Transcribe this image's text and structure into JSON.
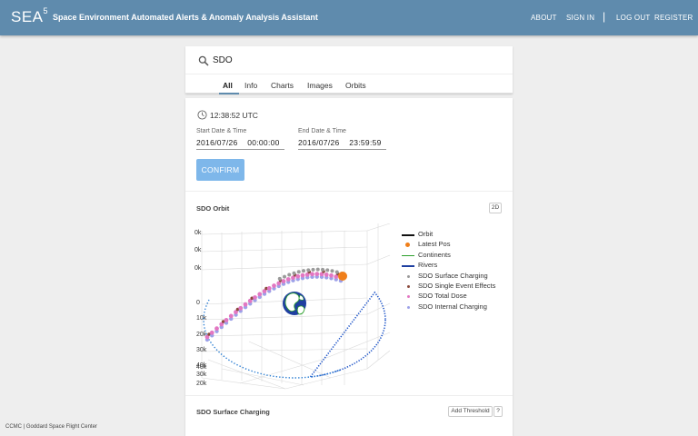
{
  "header": {
    "logo": "SEA",
    "logo_sup": "5",
    "title": "Space Environment Automated Alerts & Anomaly Analysis Assistant",
    "nav": [
      "ABOUT",
      "SIGN IN",
      "LOG OUT",
      "REGISTER"
    ],
    "separator": "|"
  },
  "search": {
    "value": "SDO"
  },
  "tabs": [
    "All",
    "Info",
    "Charts",
    "Images",
    "Orbits"
  ],
  "time": {
    "current": "12:38:52 UTC",
    "start_label": "Start Date & Time",
    "start_value": "2016/07/26    00:00:00",
    "end_label": "End Date & Time",
    "end_value": "2016/07/26    23:59:59",
    "confirm_label": "CONFIRM"
  },
  "orbit": {
    "title": "SDO Orbit",
    "toggle_label": "2D",
    "axis_ticks": [
      "0k",
      "0k",
      "0k",
      "0",
      "10k",
      "20k",
      "30k",
      "40k",
      "40k",
      "30k",
      "20k"
    ],
    "legend": [
      {
        "label": "Orbit",
        "kind": "line",
        "color": "#111111"
      },
      {
        "label": "Latest Pos",
        "kind": "dot",
        "color": "#f07f1a"
      },
      {
        "label": "Continents",
        "kind": "line",
        "color": "#2ca02c"
      },
      {
        "label": "Rivers",
        "kind": "line",
        "color": "#1f3fa0"
      },
      {
        "label": "SDO Surface Charging",
        "kind": "sdot",
        "color": "#9a9a9a"
      },
      {
        "label": "SDO Single Event Effects",
        "kind": "sdot",
        "color": "#8b4a3c"
      },
      {
        "label": "SDO Total Dose",
        "kind": "sdot",
        "color": "#e377c2"
      },
      {
        "label": "SDO Internal Charging",
        "kind": "sdot",
        "color": "#9da1e8"
      }
    ]
  },
  "surface": {
    "title": "SDO Surface Charging",
    "threshold_label": "Add Threshold",
    "help_label": "?"
  },
  "footer": {
    "text": "CCMC | Goddard Space Flight Center"
  }
}
